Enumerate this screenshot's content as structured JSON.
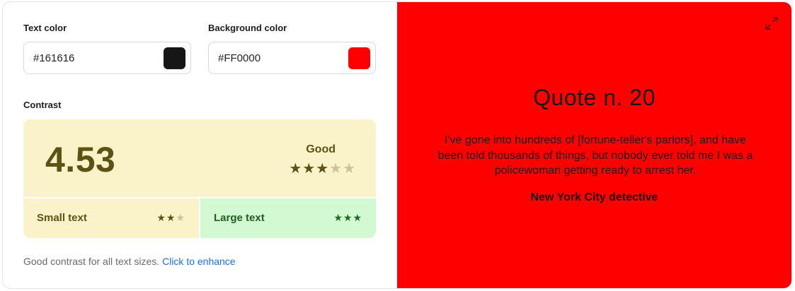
{
  "controls": {
    "text_color": {
      "label": "Text color",
      "value": "#161616",
      "swatch": "#161616"
    },
    "background_color": {
      "label": "Background color",
      "value": "#FF0000",
      "swatch": "#FF0000"
    }
  },
  "contrast": {
    "label": "Contrast",
    "ratio": "4.53",
    "rating": "Good",
    "rating_stars": {
      "filled": 3,
      "total": 5
    },
    "small_text": {
      "label": "Small text",
      "stars_filled": 2,
      "stars_total": 3
    },
    "large_text": {
      "label": "Large text",
      "stars_filled": 3,
      "stars_total": 3
    }
  },
  "footer": {
    "message": "Good contrast for all text sizes.",
    "link": "Click to enhance"
  },
  "preview": {
    "title": "Quote n. 20",
    "quote": "I've gone into hundreds of [fortune-teller's parlors], and have been told thousands of things, but nobody ever told me I was a policewoman getting ready to arrest her.",
    "author": "New York City detective",
    "icon": "expand-icon"
  },
  "colors": {
    "rating_bg": "#FAF3C9",
    "rating_fg": "#5C5213",
    "large_bg": "#D3F9D3",
    "large_fg": "#1F5E1F",
    "link": "#1f6fd1"
  }
}
